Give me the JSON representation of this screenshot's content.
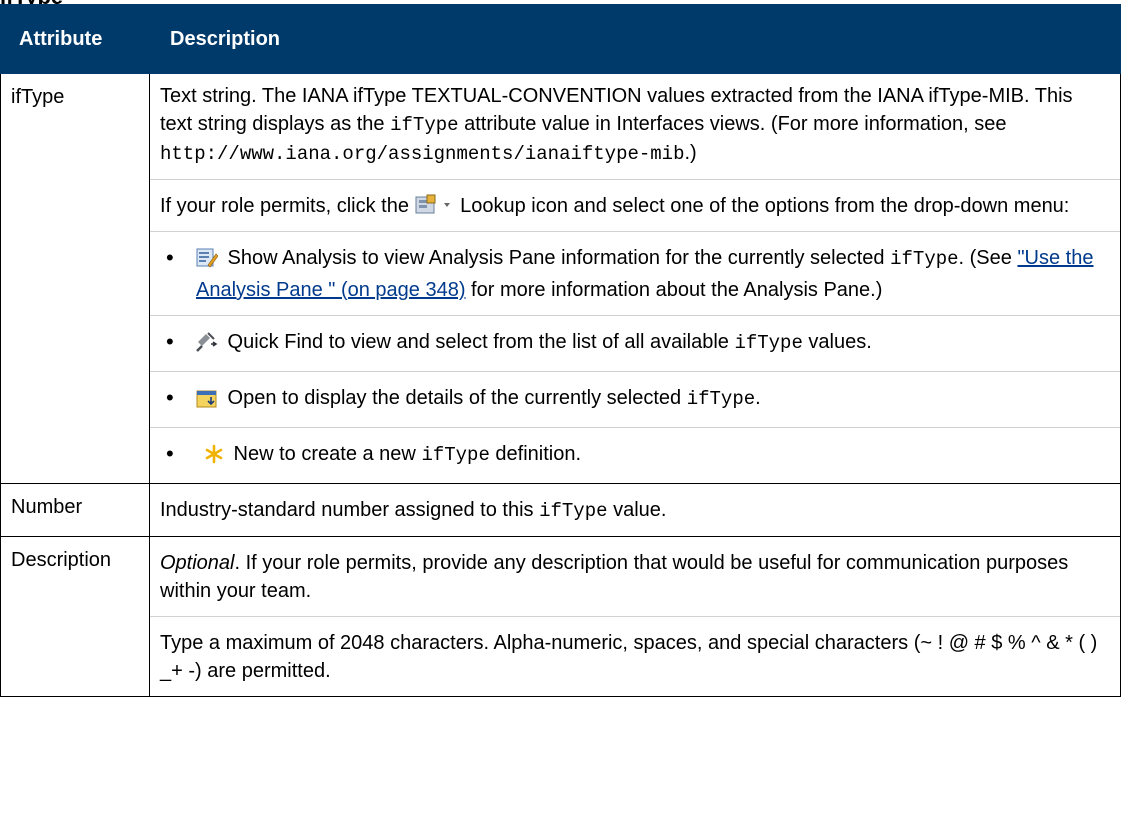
{
  "page_heading": "ifType",
  "table": {
    "headers": [
      "Attribute",
      "Description"
    ],
    "rows": [
      {
        "attribute": "ifType",
        "para1": {
          "a": "Text string. The IANA ifType TEXTUAL-CONVENTION values extracted from the IANA ifType-MIB. This text string displays as the ",
          "code": "ifType",
          "b": " attribute value in Interfaces views. (For more information, see ",
          "url": "http://www.iana.org/assignments/ianaiftype-mib",
          "c": ".)"
        },
        "para2": {
          "a": "If your role permits, click the ",
          "b": " Lookup icon and select one of the options from the drop-down menu:"
        },
        "options": [
          {
            "icon": "show-analysis-icon",
            "a": " Show Analysis to view Analysis Pane information for the currently selected ",
            "code": "ifType",
            "b": ". (See ",
            "link": "\"Use the Analysis Pane \" (on page 348)",
            "c": " for more information about the Analysis Pane.)"
          },
          {
            "icon": "quick-find-icon",
            "a": " Quick Find to view and select from the list of all available ",
            "code": "ifType",
            "b": " values."
          },
          {
            "icon": "open-icon",
            "a": " Open to display the details of the currently selected ",
            "code": "ifType",
            "b": "."
          },
          {
            "icon": "new-icon",
            "a": " New to create a new ",
            "code": "ifType",
            "b": " definition."
          }
        ]
      },
      {
        "attribute": "Number",
        "a": "Industry-standard number assigned to this ",
        "code": "ifType",
        "b": " value."
      },
      {
        "attribute": "Description",
        "optional": "Optional",
        "p1": ". If your role permits, provide any description that would be useful for communication purposes within your team.",
        "p2": "Type a maximum of 2048 characters. Alpha-numeric, spaces, and special characters (~ ! @ # $ % ^ & * ( ) _+ -) are permitted."
      }
    ]
  },
  "colors": {
    "header_bg": "#003a6b",
    "link": "#003a8c"
  }
}
